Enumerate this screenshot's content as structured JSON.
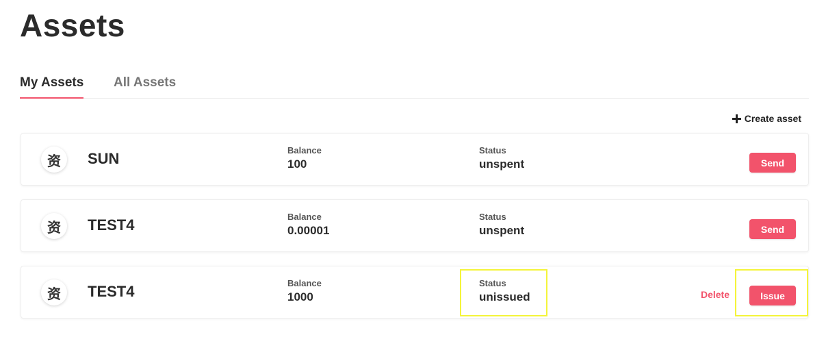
{
  "page": {
    "title": "Assets"
  },
  "tabs": [
    {
      "label": "My Assets",
      "active": true
    },
    {
      "label": "All Assets",
      "active": false
    }
  ],
  "toolbar": {
    "create_label": "Create asset",
    "create_icon": "plus-icon"
  },
  "assets": [
    {
      "avatar": "资",
      "name": "SUN",
      "balance_label": "Balance",
      "balance": "100",
      "status_label": "Status",
      "status": "unspent",
      "primary_action": "Send"
    },
    {
      "avatar": "资",
      "name": "TEST4",
      "balance_label": "Balance",
      "balance": "0.00001",
      "status_label": "Status",
      "status": "unspent",
      "primary_action": "Send"
    },
    {
      "avatar": "资",
      "name": "TEST4",
      "balance_label": "Balance",
      "balance": "1000",
      "status_label": "Status",
      "status": "unissued",
      "primary_action": "Issue",
      "secondary_action": "Delete"
    }
  ],
  "colors": {
    "accent": "#f2536b",
    "highlight": "#f4f43a",
    "text": "#2b2b2b"
  }
}
